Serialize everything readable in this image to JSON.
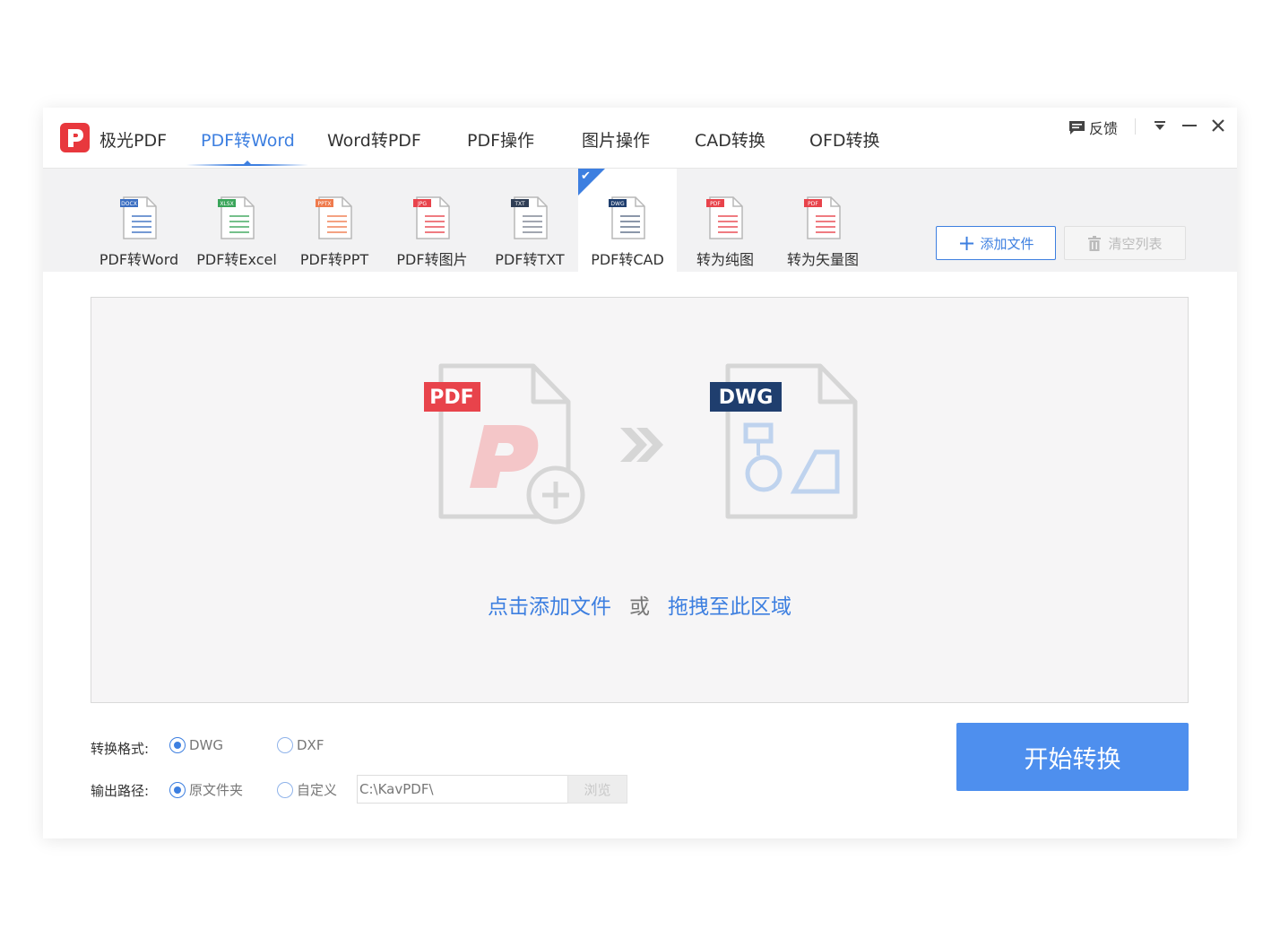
{
  "header": {
    "app_name": "极光PDF",
    "nav": [
      "PDF转Word",
      "Word转PDF",
      "PDF操作",
      "图片操作",
      "CAD转换",
      "OFD转换"
    ],
    "active_nav": "PDF转Word",
    "feedback": "反馈"
  },
  "toolbar": {
    "tools": [
      {
        "label": "PDF转Word",
        "badge": "DOCX",
        "badge_color": "#3b6fc2"
      },
      {
        "label": "PDF转Excel",
        "badge": "XLSX",
        "badge_color": "#3aa55a"
      },
      {
        "label": "PDF转PPT",
        "badge": "PPTX",
        "badge_color": "#ef7b4d"
      },
      {
        "label": "PDF转图片",
        "badge": "JPG",
        "badge_color": "#e8434b"
      },
      {
        "label": "PDF转TXT",
        "badge": "TXT",
        "badge_color": "#2f3e55"
      },
      {
        "label": "PDF转CAD",
        "badge": "DWG",
        "badge_color": "#1f3e6e"
      },
      {
        "label": "转为纯图",
        "badge": "PDF",
        "badge_color": "#e8434b"
      },
      {
        "label": "转为矢量图",
        "badge": "PDF",
        "badge_color": "#e8434b"
      }
    ],
    "active_tool": "PDF转CAD",
    "add_file": "添加文件",
    "clear_list": "清空列表"
  },
  "dropzone": {
    "source_badge": "PDF",
    "target_badge": "DWG",
    "click_add": "点击添加文件",
    "or": "或",
    "drag_here": "拖拽至此区域"
  },
  "options": {
    "format_label": "转换格式:",
    "format_options": [
      "DWG",
      "DXF"
    ],
    "format_selected": "DWG",
    "output_label": "输出路径:",
    "output_options": [
      "原文件夹",
      "自定义"
    ],
    "output_selected": "原文件夹",
    "path_value": "C:\\KavPDF\\",
    "browse": "浏览"
  },
  "start_button": "开始转换",
  "colors": {
    "accent": "#3d7fe0",
    "start_button": "#4e8fee",
    "logo": "#e8383d",
    "pdf_badge": "#e8434b",
    "dwg_badge": "#1f3e6e"
  }
}
